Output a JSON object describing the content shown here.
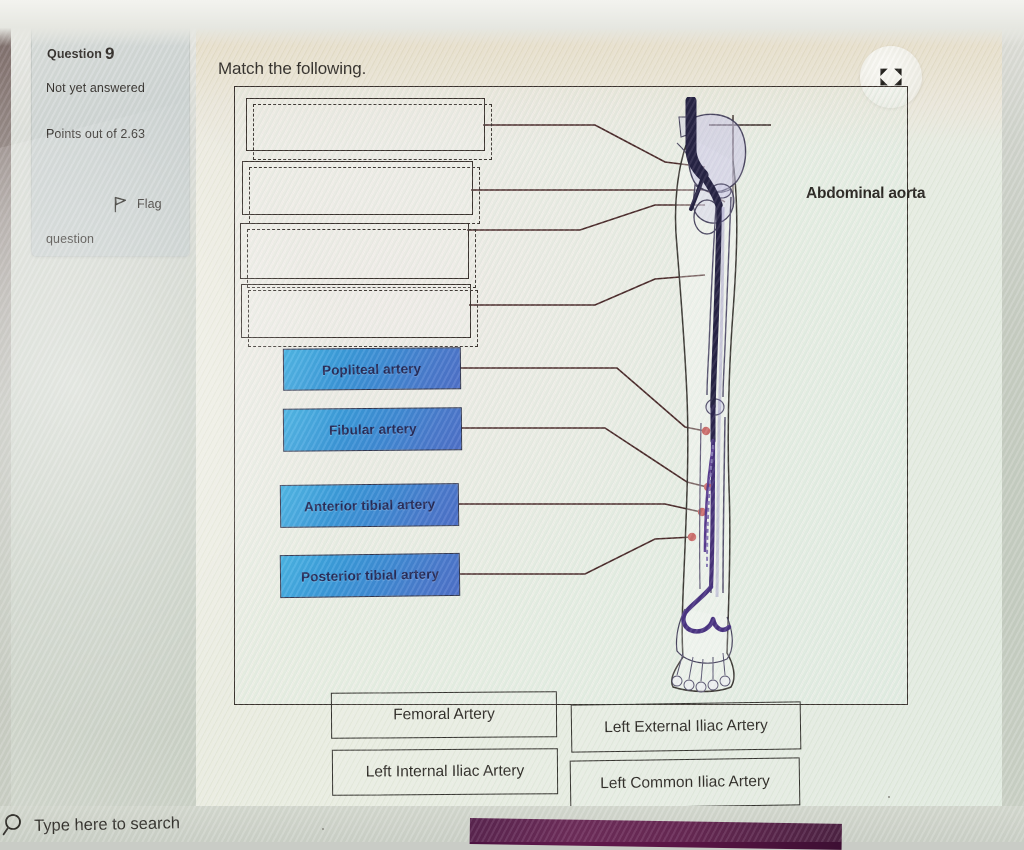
{
  "question_panel": {
    "question_label": "Question",
    "question_number": "9",
    "status": "Not yet answered",
    "points": "Points out of 2.63",
    "flag_label": "Flag",
    "flag_label2": "question",
    "flag_icon": "flag-icon"
  },
  "main": {
    "prompt": "Match the following.",
    "expand_icon": "expand-fullscreen-icon"
  },
  "diagram": {
    "aorta_label": "Abdominal aorta",
    "dropzones": [
      {
        "value": "",
        "placeholder": ""
      },
      {
        "value": "",
        "placeholder": ""
      },
      {
        "value": "",
        "placeholder": ""
      },
      {
        "value": "",
        "placeholder": ""
      }
    ],
    "placed_answers": [
      "Popliteal artery",
      "Fibular artery",
      "Anterior tibial artery",
      "Posterior tibial artery"
    ]
  },
  "options": [
    "Femoral Artery",
    "Left External Iliac Artery",
    "Left Internal Iliac Artery",
    "Left Common Iliac Artery"
  ],
  "taskbar": {
    "search_placeholder": "Type here to search",
    "search_icon": "search-icon"
  },
  "colors": {
    "answer_box_blue": "#2f8fd6",
    "answer_box_text": "#14184a",
    "line": "#3a1718",
    "frame": "#2a211d",
    "marker_dot": "#b0201f",
    "artery_dark": "#141034",
    "artery_purple": "#4a2a86"
  }
}
